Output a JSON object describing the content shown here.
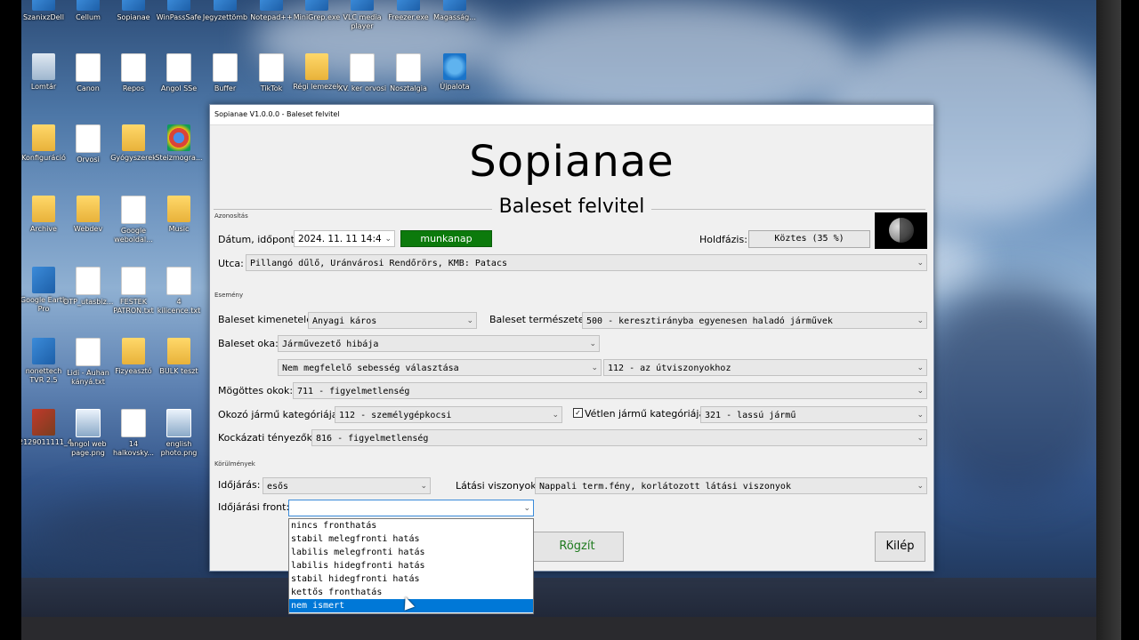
{
  "desktop_icons": [
    {
      "label": "SzanixzDell",
      "type": "app"
    },
    {
      "label": "Cellum",
      "type": "app"
    },
    {
      "label": "Sopianae",
      "type": "app"
    },
    {
      "label": "WinPassSafe",
      "type": "app"
    },
    {
      "label": "Jegyzettömb",
      "type": "app"
    },
    {
      "label": "Notepad++",
      "type": "app"
    },
    {
      "label": "MiniGrep.exe",
      "type": "app"
    },
    {
      "label": "VLC media player",
      "type": "app"
    },
    {
      "label": "Freezer.exe",
      "type": "app"
    },
    {
      "label": "Magasság...",
      "type": "app"
    },
    {
      "label": "Lomtár",
      "type": "recycle"
    },
    {
      "label": "Canon",
      "type": "doc"
    },
    {
      "label": "Repos",
      "type": "doc"
    },
    {
      "label": "Angol SSe",
      "type": "doc"
    },
    {
      "label": "Buffer",
      "type": "doc"
    },
    {
      "label": "TikTok",
      "type": "doc"
    },
    {
      "label": "Régi lemezek",
      "type": "folder"
    },
    {
      "label": "XV. ker orvosi",
      "type": "doc"
    },
    {
      "label": "Nosztalgia",
      "type": "doc"
    },
    {
      "label": "Újpalota",
      "type": "ie"
    },
    {
      "label": "Konfiguráció",
      "type": "folder"
    },
    {
      "label": "Orvosi",
      "type": "doc"
    },
    {
      "label": "Gyógyszerek",
      "type": "folder"
    },
    {
      "label": "Steizmogra...",
      "type": "chrome"
    },
    {
      "label": "Archive",
      "type": "folder"
    },
    {
      "label": "Webdev",
      "type": "folder"
    },
    {
      "label": "Google weboldal...",
      "type": "doc"
    },
    {
      "label": "Music",
      "type": "folder"
    },
    {
      "label": "Google Earth Pro",
      "type": "app"
    },
    {
      "label": "OTP_utasbiz...",
      "type": "doc"
    },
    {
      "label": "FESTEK PATRON.txt",
      "type": "doc"
    },
    {
      "label": "4 kilicence.txt",
      "type": "doc"
    },
    {
      "label": "nonettech TVR 2.5",
      "type": "app"
    },
    {
      "label": "Lidi - Auhan kányá.txt",
      "type": "doc"
    },
    {
      "label": "Fizyeasztó",
      "type": "folder"
    },
    {
      "label": "BULK teszt",
      "type": "folder"
    },
    {
      "label": "2129011111_4...",
      "type": "photo"
    },
    {
      "label": "angol web page.png",
      "type": "screen"
    },
    {
      "label": "14 halkovsky...",
      "type": "doc"
    },
    {
      "label": "english photo.png",
      "type": "screen"
    }
  ],
  "window": {
    "title": "Sopianae V1.0.0.0 - Baleset felvitel",
    "app_name": "Sopianae",
    "subtitle": "Baleset felvitel"
  },
  "azonositas": {
    "group_label": "Azonosítás",
    "datum_label": "Dátum, időpont:",
    "datum_value": "2024. 11. 11 14:4",
    "munkanap": "munkanap",
    "holdfazis_label": "Holdfázis:",
    "holdfazis_value": "Köztes (35 %)",
    "utca_label": "Utca:",
    "utca_value": "Pillangó dűlő, Uránvárosi Rendőrörs, KMB: Patacs"
  },
  "esemeny": {
    "group_label": "Esemény",
    "kimenetel_label": "Baleset kimenetele:",
    "kimenetel_value": "Anyagi káros",
    "termeszet_label": "Baleset természete:",
    "termeszet_value": "500 - keresztirányba egyenesen haladó járművek",
    "ok_label": "Baleset oka:",
    "ok_value": "Járművezető hibája",
    "ok_sub1": "Nem megfelelő sebesség választása",
    "ok_sub2": "112 - az útviszonyokhoz",
    "mogottes_label": "Mögöttes okok:",
    "mogottes_value": "711 - figyelmetlenség",
    "okozo_label": "Okozó jármű kategóriája:",
    "okozo_value": "112 - személygépkocsi",
    "vetlen_checked": "✓",
    "vetlen_label": "Vétlen jármű kategóriája:",
    "vetlen_value": "321 - lassú jármű",
    "kockazati_label": "Kockázati tényezők:",
    "kockazati_value": "816 - figyelmetlenség"
  },
  "korulmenyek": {
    "group_label": "Körülmények",
    "idojaras_label": "Időjárás:",
    "idojaras_value": "esős",
    "latasi_label": "Látási viszonyok:",
    "latasi_value": "Nappali term.fény, korlátozott látási viszonyok",
    "front_label": "Időjárási front:",
    "front_value": "",
    "front_options": [
      "nincs fronthatás",
      "stabil melegfronti hatás",
      "labilis melegfronti hatás",
      "labilis hidegfronti hatás",
      "stabil hidegfronti hatás",
      "kettős fronthatás",
      "nem ismert"
    ],
    "front_highlighted": "nem ismert"
  },
  "buttons": {
    "rogzit": "Rögzít",
    "klep": "Kilép"
  },
  "colors": {
    "munkanap_bg": "#0c7a0c",
    "selection": "#0078d7",
    "rogzit_text": "#1e7a1e"
  }
}
